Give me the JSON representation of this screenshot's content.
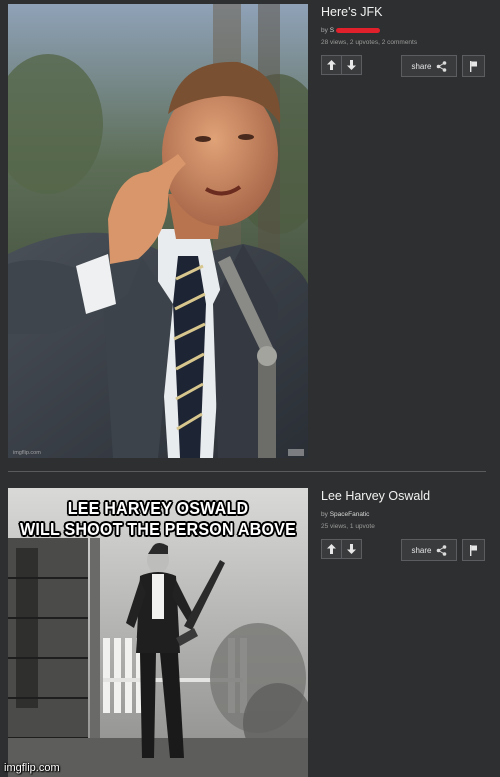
{
  "posts": [
    {
      "title": "Here's JFK",
      "by_label": "by",
      "author": "S",
      "stats": "28 views, 2 upvotes, 2 comments",
      "share_label": "share",
      "thumb_watermark": "imgflip.com"
    },
    {
      "title": "Lee Harvey Oswald",
      "by_label": "by",
      "author": "SpaceFanatic",
      "stats": "25 views, 1 upvote",
      "share_label": "share",
      "meme_caption_line1": "LEE HARVEY OSWALD",
      "meme_caption_line2": "WILL SHOOT THE PERSON ABOVE"
    }
  ],
  "footer_watermark": "imgflip.com",
  "colors": {
    "background": "#2e2f30",
    "button_border": "#5c5d60",
    "redaction": "#e0202a"
  },
  "icons": [
    "upvote-arrow-icon",
    "downvote-arrow-icon",
    "share-icon",
    "flag-icon"
  ]
}
